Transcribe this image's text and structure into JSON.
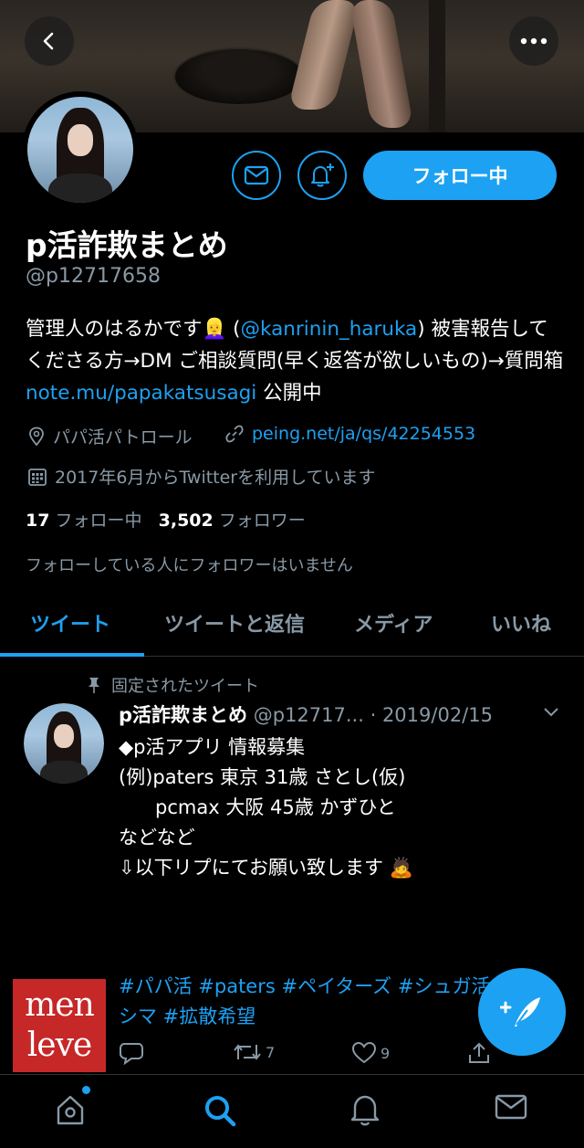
{
  "header": {
    "back_icon": "chevron-left-icon",
    "more_icon": "more-horizontal-icon"
  },
  "profile": {
    "name": "p活詐欺まとめ",
    "handle": "@p12717658",
    "follow_button": "フォロー中",
    "bio_text_1": "管理人のはるかです",
    "bio_emoji": "👱‍♀️",
    "bio_mention": "@kanrinin_haruka",
    "bio_text_2": " 被害報告してくださる方→DM ご相談質問(早く返答が欲しいもの)→質問箱 ",
    "bio_link": "note.mu/papakatsusagi",
    "bio_text_3": " 公開中",
    "location": "パパ活パトロール",
    "website": "peing.net/ja/qs/42254553",
    "joined": "2017年6月からTwitterを利用しています",
    "following_count": "17",
    "following_label": "フォロー中",
    "followers_count": "3,502",
    "followers_label": "フォロワー",
    "no_mutual": "フォローしている人にフォロワーはいません"
  },
  "tabs": [
    {
      "label": "ツイート",
      "active": true
    },
    {
      "label": "ツイートと返信",
      "active": false
    },
    {
      "label": "メディア",
      "active": false
    },
    {
      "label": "いいね",
      "active": false
    }
  ],
  "tweet": {
    "pinned_label": "固定されたツイート",
    "name": "p活詐欺まとめ",
    "handle": "@p12717...",
    "date": "· 2019/02/15",
    "lines": [
      "◆p活アプリ 情報募集",
      "",
      "(例)paters 東京 31歳 さとし(仮)",
      "      pcmax 大阪 45歳 かずひと",
      "などなど",
      "",
      "⇩以下リプにてお願い致します 🙇"
    ],
    "hashtags": "#パパ活 #paters #ペイターズ #シュガ活 #ピシマ #拡散希望",
    "reply_count": "",
    "retweet_count": "7",
    "like_count": "9"
  },
  "watermark": {
    "line1": "men",
    "line2": "leve"
  },
  "bottom_nav": [
    "home-icon",
    "search-icon",
    "notifications-icon",
    "messages-icon"
  ],
  "colors": {
    "accent": "#1da1f2",
    "background": "#000000",
    "secondary_text": "#8899a6"
  }
}
